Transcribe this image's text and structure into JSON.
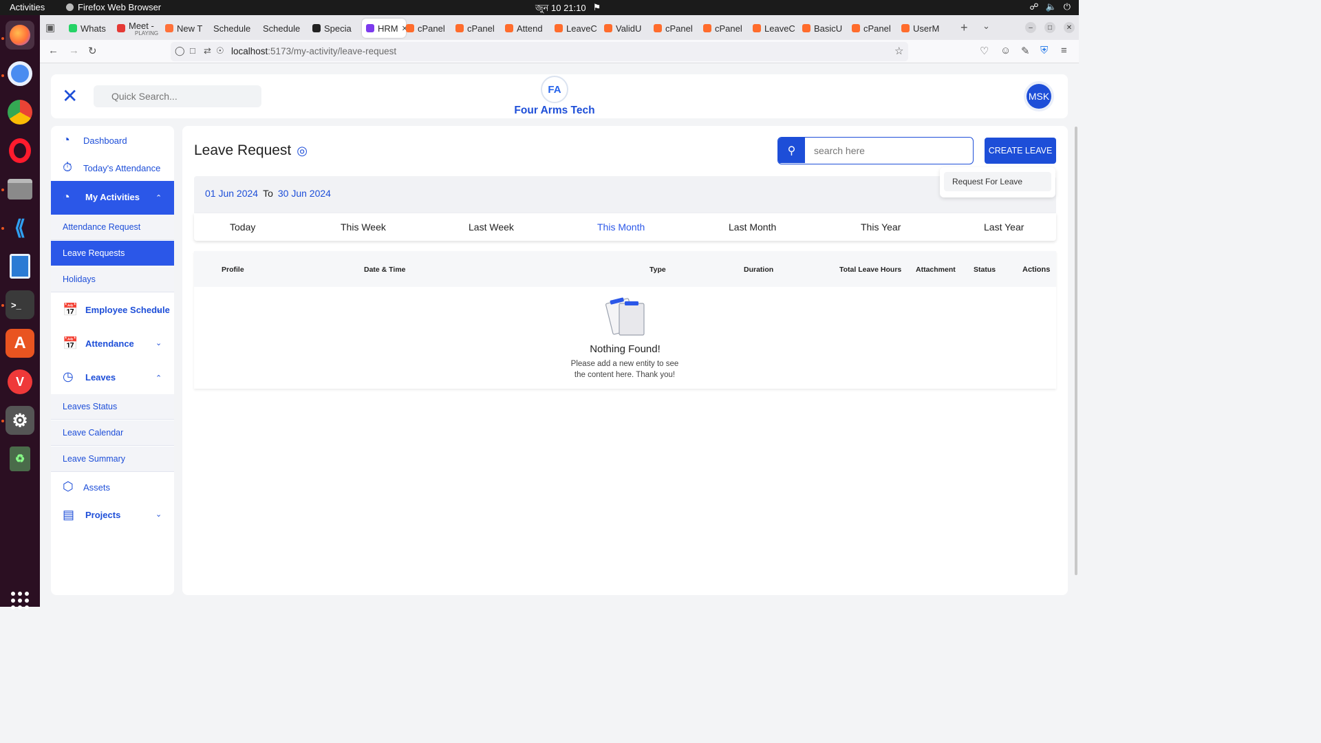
{
  "os": {
    "activities": "Activities",
    "app_name": "Firefox Web Browser",
    "clock": "জুন 10  21:10"
  },
  "browser": {
    "tabs": [
      {
        "label": "Whats",
        "icon_color": "#25d366"
      },
      {
        "label": "Meet -",
        "sub": "PLAYING",
        "icon_color": "#e53935"
      },
      {
        "label": "New T",
        "icon_color": "#ff7139"
      },
      {
        "label": "Schedule",
        "icon_color": ""
      },
      {
        "label": "Schedule",
        "icon_color": ""
      },
      {
        "label": "Specia",
        "icon_color": "#222222"
      },
      {
        "label": "HRM",
        "icon_color": "#7c3aed",
        "active": true
      },
      {
        "label": "cPanel",
        "icon_color": "#ff6c2c"
      },
      {
        "label": "cPanel",
        "icon_color": "#ff6c2c"
      },
      {
        "label": "Attend",
        "icon_color": "#ff6c2c"
      },
      {
        "label": "LeaveC",
        "icon_color": "#ff6c2c"
      },
      {
        "label": "ValidU",
        "icon_color": "#ff6c2c"
      },
      {
        "label": "cPanel",
        "icon_color": "#ff6c2c"
      },
      {
        "label": "cPanel",
        "icon_color": "#ff6c2c"
      },
      {
        "label": "LeaveC",
        "icon_color": "#ff6c2c"
      },
      {
        "label": "BasicU",
        "icon_color": "#ff6c2c"
      },
      {
        "label": "cPanel",
        "icon_color": "#ff6c2c"
      },
      {
        "label": "UserM",
        "icon_color": "#ff6c2c"
      }
    ],
    "url_host": "localhost",
    "url_path": ":5173/my-activity/leave-request"
  },
  "header": {
    "search_placeholder": "Quick Search...",
    "logo_text": "FA",
    "company": "Four Arms Tech",
    "avatar": "MSK"
  },
  "sidebar": {
    "dashboard": "Dashboard",
    "todays_attendance": "Today's Attendance",
    "my_activities": "My Activities",
    "attendance_request": "Attendance Request",
    "leave_requests": "Leave Requests",
    "holidays": "Holidays",
    "employee_schedule": "Employee Schedule",
    "attendance": "Attendance",
    "leaves": "Leaves",
    "leaves_status": "Leaves Status",
    "leave_calendar": "Leave Calendar",
    "leave_summary": "Leave Summary",
    "assets": "Assets",
    "projects": "Projects"
  },
  "main": {
    "title": "Leave Request",
    "search_placeholder": "search here",
    "create_button": "CREATE LEAVE",
    "dropdown_item": "Request For Leave",
    "date_from": "01 Jun 2024",
    "date_to_word": "To",
    "date_to": "30 Jun 2024",
    "filters": [
      "Today",
      "This Week",
      "Last Week",
      "This Month",
      "Last Month",
      "This Year",
      "Last Year"
    ],
    "active_filter": "This Month",
    "columns": [
      "Profile",
      "Date & Time",
      "Type",
      "Duration",
      "Total Leave Hours",
      "Attachment",
      "Status",
      "Actions"
    ],
    "empty_title": "Nothing Found!",
    "empty_message": "Please add a new entity to see the content here. Thank you!"
  },
  "colors": {
    "accent": "#1d4ed8",
    "active_nav": "#2b57e8"
  }
}
